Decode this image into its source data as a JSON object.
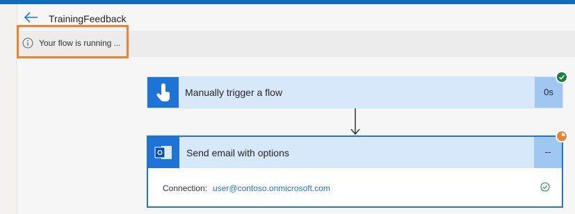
{
  "header": {
    "title": "TrainingFeedback"
  },
  "notice": {
    "text": "Your flow is running ..."
  },
  "steps": [
    {
      "label": "Manually trigger a flow",
      "duration": "0s",
      "status": "succeeded"
    },
    {
      "label": "Send email with options",
      "duration": "--",
      "status": "running",
      "connection_label": "Connection:",
      "connection_value": "user@contoso.onmicrosoft.com"
    }
  ],
  "icons": {
    "back": "arrow-left-icon",
    "info": "info-icon",
    "trigger": "touch-hand-icon",
    "outlook": "outlook-icon",
    "success": "check-circle-icon",
    "running": "clock-icon"
  },
  "colors": {
    "accent": "#1e73d6",
    "highlight": "#f0812f",
    "success": "#13823f"
  }
}
